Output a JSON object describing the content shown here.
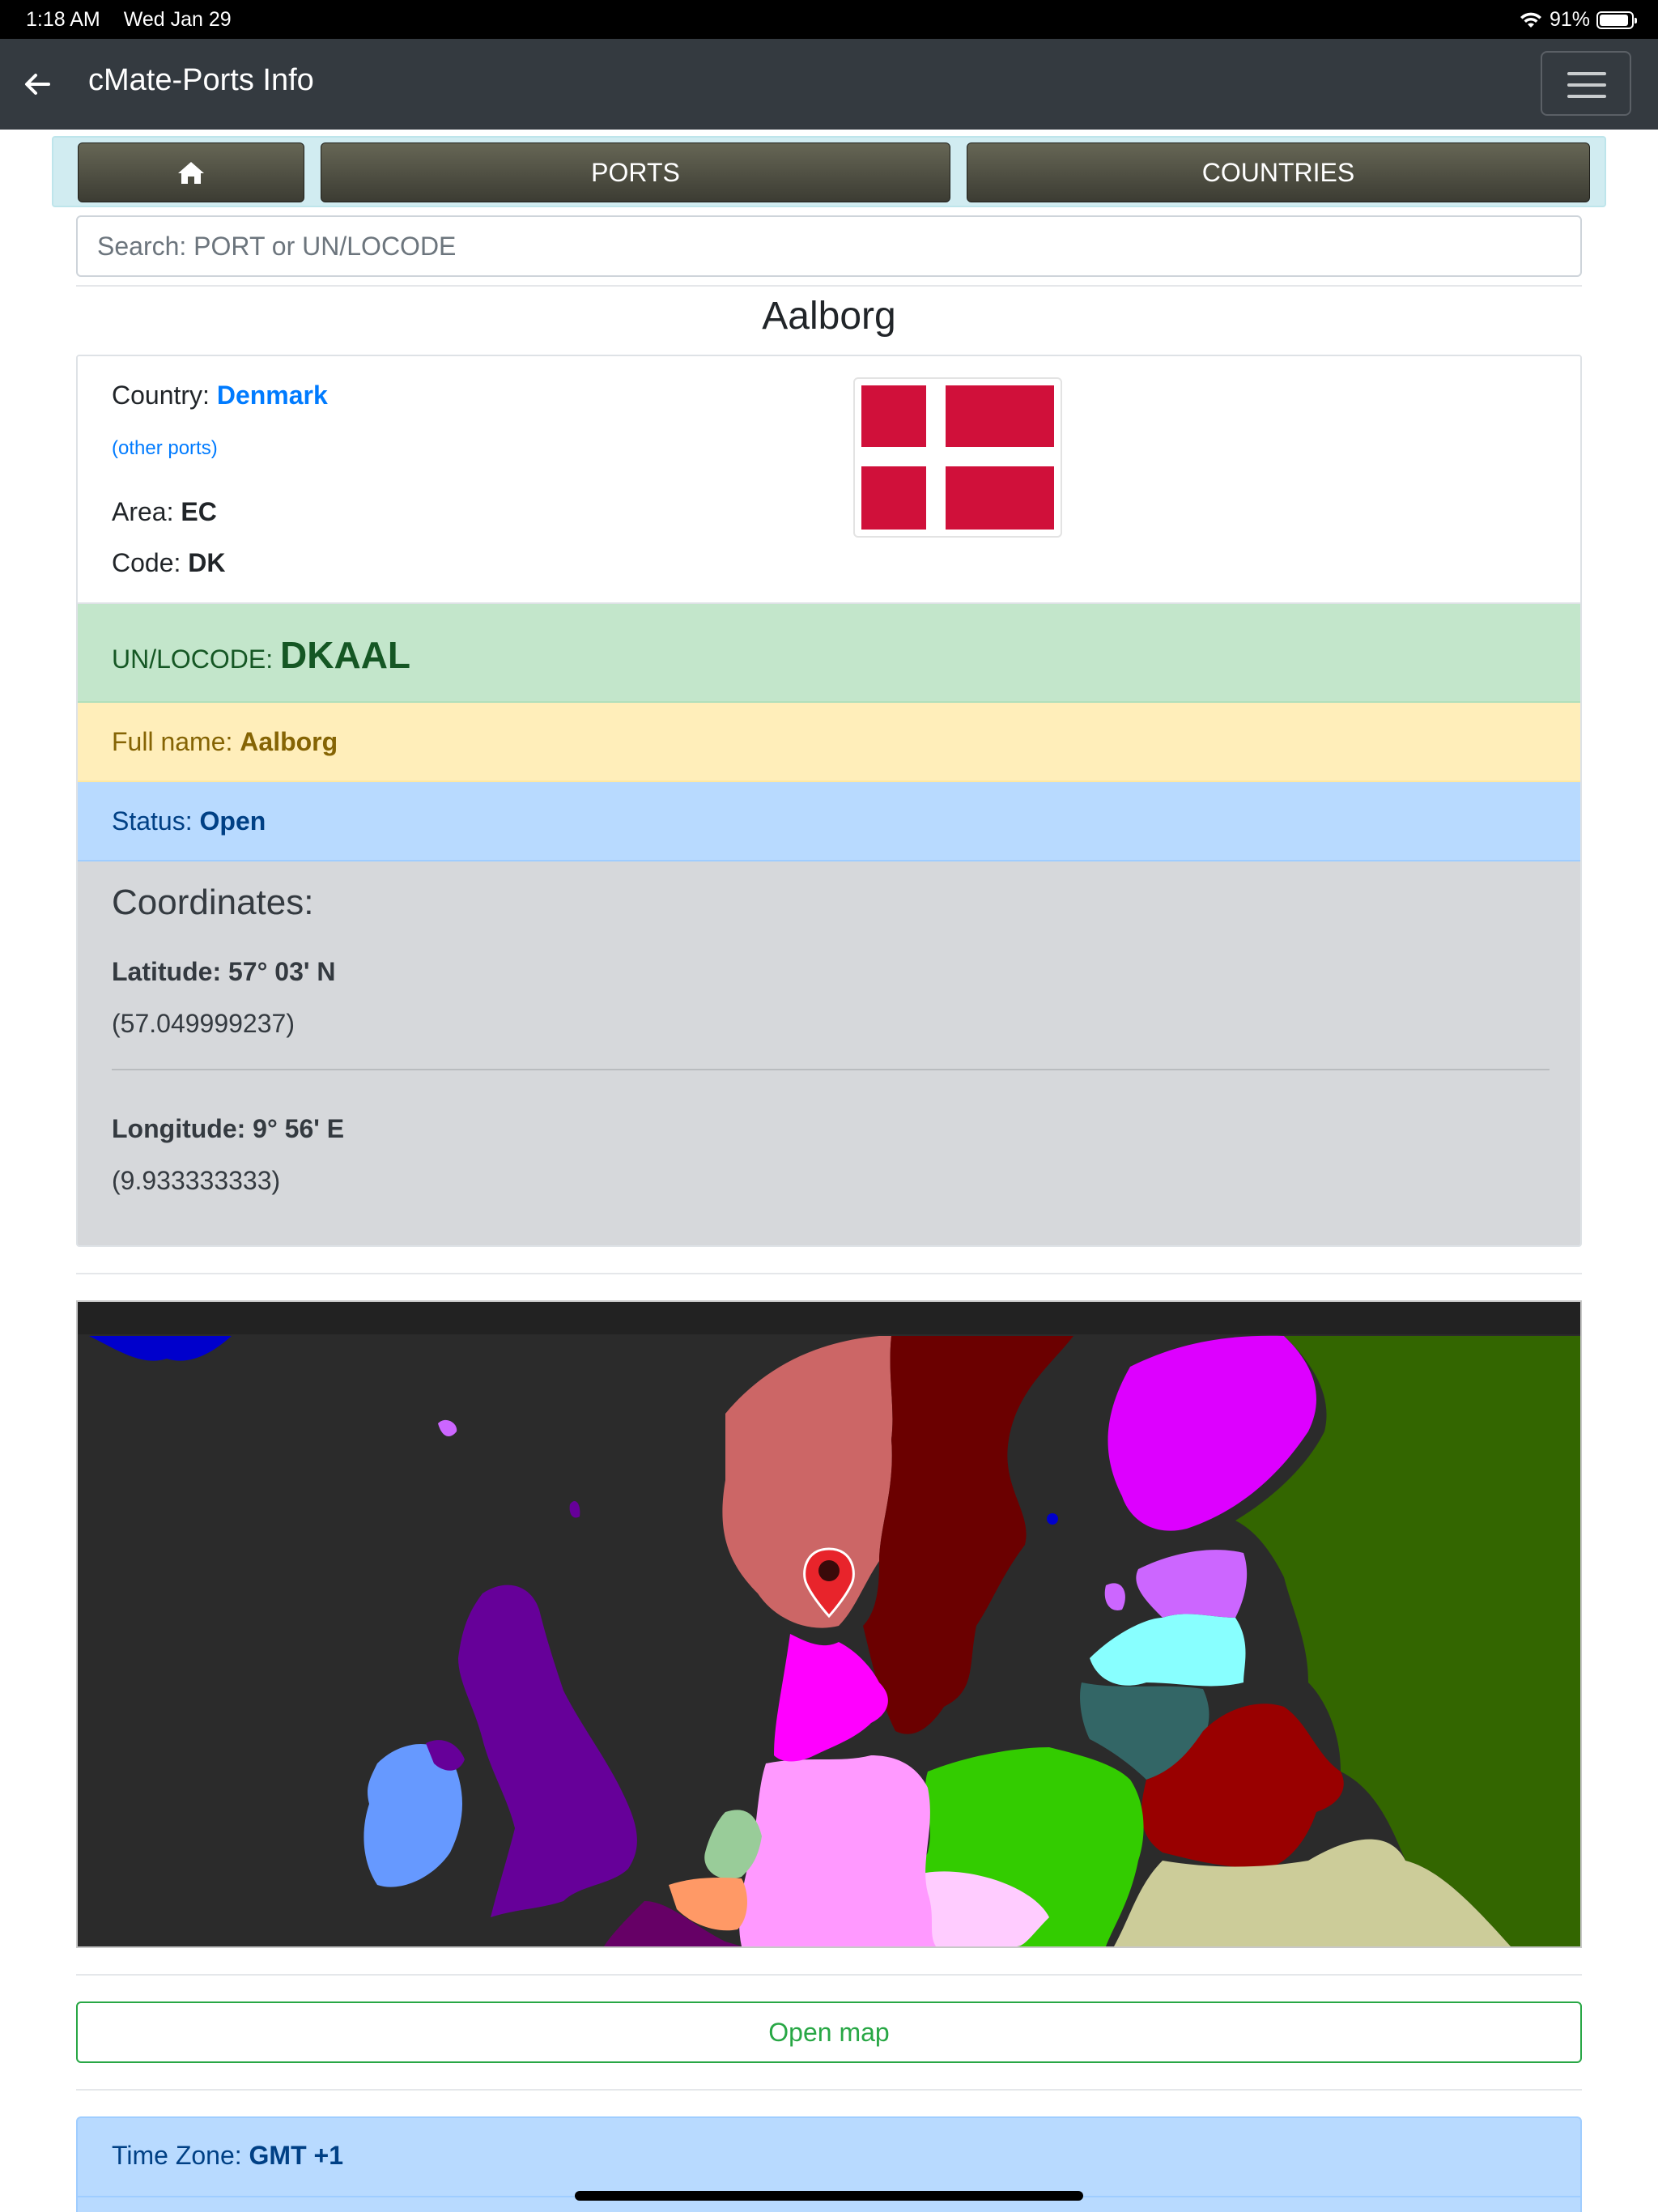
{
  "status_bar": {
    "time": "1:18 AM",
    "date": "Wed Jan 29",
    "battery_pct": "91%",
    "battery_level": 0.91
  },
  "navbar": {
    "title": "cMate-Ports Info",
    "back_icon": "arrow-left-icon",
    "menu_icon": "hamburger-icon"
  },
  "topnav": {
    "home_icon": "home-icon",
    "ports_label": "PORTS",
    "countries_label": "COUNTRIES"
  },
  "search": {
    "placeholder": "Search: PORT or UN/LOCODE",
    "value": ""
  },
  "port": {
    "name": "Aalborg",
    "country_label": "Country:",
    "country": "Denmark",
    "other_ports": "(other ports)",
    "area_label": "Area:",
    "area": "EC",
    "code_label": "Code:",
    "code": "DK",
    "unlocode_label": "UN/LOCODE:",
    "unlocode": "DKAAL",
    "fullname_label": "Full name:",
    "fullname": "Aalborg",
    "status_label": "Status:",
    "status": "Open"
  },
  "coordinates": {
    "heading": "Coordinates:",
    "latitude": "Latitude: 57° 03' N",
    "latitude_decimal": "(57.049999237)",
    "longitude": "Longitude: 9° 56' E",
    "longitude_decimal": "(9.933333333)"
  },
  "map": {
    "marker_icon": "map-pin-icon"
  },
  "buttons": {
    "open_map": "Open map"
  },
  "timezone": {
    "label": "Time Zone:",
    "value": "GMT +1"
  },
  "colors": {
    "navbar": "#343a40",
    "link": "#007bff",
    "success_bg": "#c3e6cb",
    "warning_bg": "#ffeeba",
    "info_bg": "#b8daff",
    "coords_bg": "#d6d8db",
    "flag_red": "#d0103a"
  }
}
